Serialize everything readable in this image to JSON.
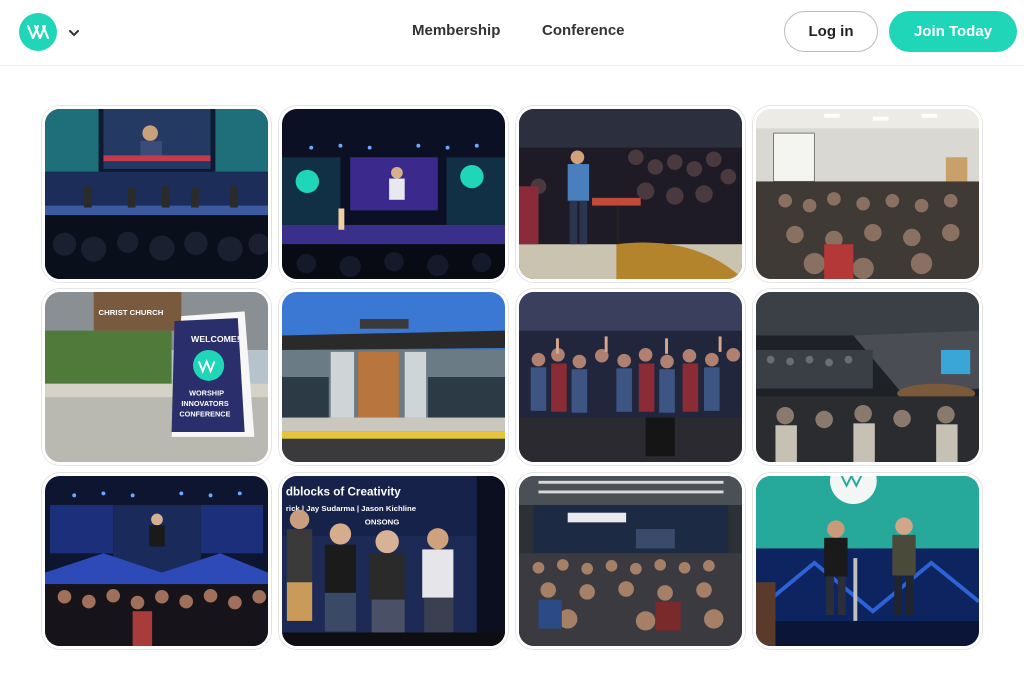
{
  "header": {
    "logo_icon": "wi-logo-icon",
    "menu_icon": "chevron-down-icon",
    "nav": [
      {
        "label": "Membership"
      },
      {
        "label": "Conference"
      }
    ],
    "login_label": "Log in",
    "join_label": "Join Today"
  },
  "colors": {
    "brand": "#1fd6b8",
    "border": "#ececec"
  },
  "gallery": {
    "photos": [
      {
        "name": "worship-band-stage-photo"
      },
      {
        "name": "conference-keynote-stage-photo"
      },
      {
        "name": "keyboard-worship-leader-photo"
      },
      {
        "name": "seminar-room-audience-photo"
      },
      {
        "name": "christ-church-welcome-sign-photo",
        "sign_title": "WELCOME!",
        "sign_line1": "WORSHIP",
        "sign_line2": "INNOVATORS",
        "sign_line3": "CONFERENCE",
        "building_sign": "CHRIST CHURCH"
      },
      {
        "name": "church-building-exterior-photo"
      },
      {
        "name": "crowd-worshipping-photo"
      },
      {
        "name": "large-auditorium-photo"
      },
      {
        "name": "sound-like-you-session-photo"
      },
      {
        "name": "panel-discussion-photo",
        "banner_title": "dblocks of Creativity",
        "banner_names": "rick | Jay Sudarma | Jason Kichline",
        "banner_sponsor": "ONSONG"
      },
      {
        "name": "breakout-session-photo"
      },
      {
        "name": "teal-stage-interview-photo"
      }
    ]
  }
}
